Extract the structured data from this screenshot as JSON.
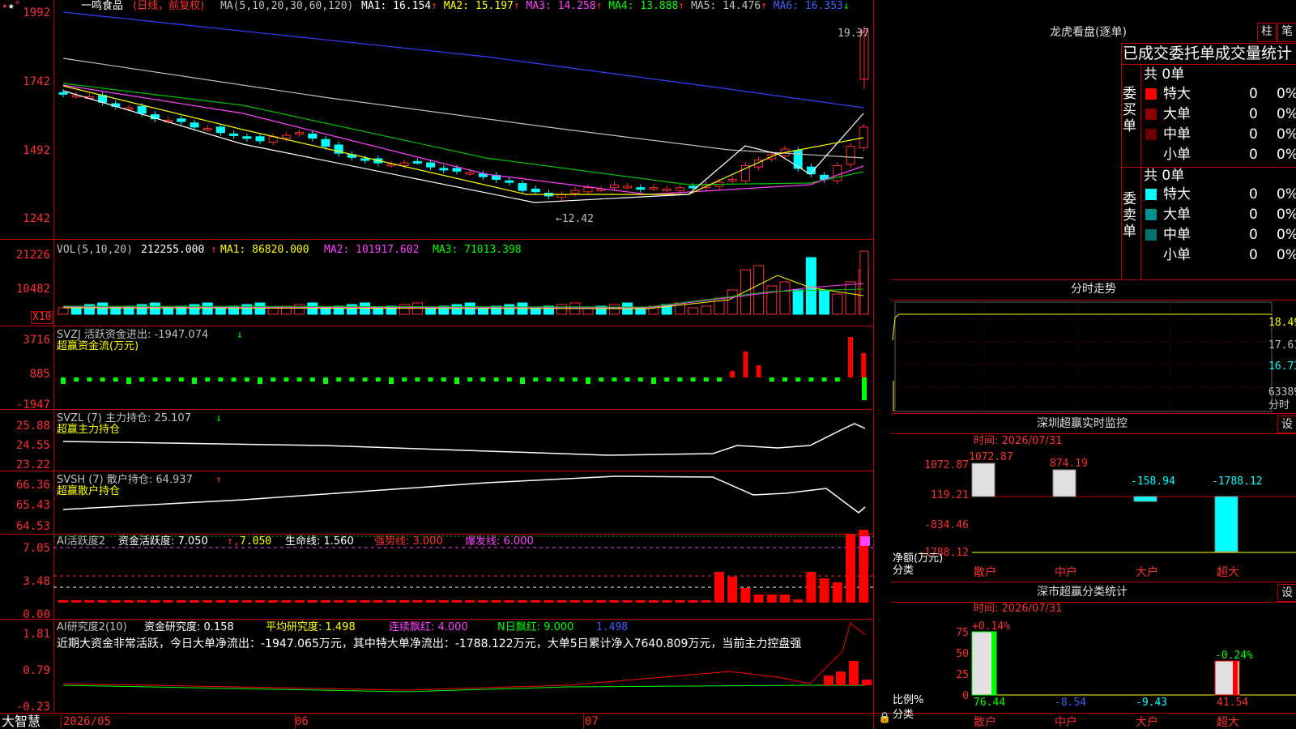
{
  "stock": {
    "name": "一鸣食品",
    "period": "(日线，前复权)"
  },
  "ma": {
    "label": "MA(5,10,20,30,60,120)",
    "items": [
      {
        "name": "MA1:",
        "value": "16.154",
        "arrow": "↑",
        "color": "#ffffff"
      },
      {
        "name": "MA2:",
        "value": "15.197",
        "arrow": "↑",
        "color": "#ffff00"
      },
      {
        "name": "MA3:",
        "value": "14.258",
        "arrow": "↑",
        "color": "#ff40ff"
      },
      {
        "name": "MA4:",
        "value": "13.888",
        "arrow": "↑",
        "color": "#00ff00"
      },
      {
        "name": "MA5:",
        "value": "14.476",
        "arrow": "↑",
        "color": "#c0c0c0"
      },
      {
        "name": "MA6:",
        "value": "16.353",
        "arrow": "↓",
        "color": "#4060ff"
      }
    ]
  },
  "price_axis": [
    "1992",
    "1742",
    "1492",
    "1242"
  ],
  "price_labels": {
    "high": "19.37",
    "low": "←12.42"
  },
  "vol": {
    "label": "VOL(5,10,20)",
    "value": "212255.000",
    "ma1": "MA1: 86820.000",
    "ma2": "MA2: 101917.602",
    "ma3": "MA3: 71013.398",
    "axis": [
      "21226",
      "10482"
    ],
    "unit": "X10"
  },
  "svzj": {
    "label": "SVZJ  活跃资金进出: -1947.074",
    "arrow": "↓",
    "sub": "超赢资金流(万元)",
    "axis": [
      "3716",
      "885",
      "-1947"
    ]
  },
  "svzl": {
    "label": "SVZL (7) 主力持仓: 25.107",
    "arrow": "↓",
    "sub": "超赢主力持仓",
    "axis": [
      "25.88",
      "24.55",
      "23.22"
    ]
  },
  "svsh": {
    "label": "SVSH (7) 散户持仓: 64.937",
    "arrow": "↑",
    "sub": "超赢散户持仓",
    "axis": [
      "66.36",
      "65.43",
      "64.53"
    ]
  },
  "ai1": {
    "label": "AI活跃度2",
    "a": "资金活跃度: 7.050",
    "b": "7.050",
    "c": "生命线: 1.560",
    "d": "强势线: 3.000",
    "e": "爆发线: 6.000",
    "axis": [
      "7.05",
      "3.48",
      "0.00"
    ]
  },
  "ai2": {
    "label": "AI研究度2(10)",
    "a": "资金研究度: 0.158",
    "b": "平均研究度: 1.498",
    "c": "连续飘红: 4.000",
    "d": "N日飘红: 9.000",
    "e": "1.498",
    "summary": "近期大资金非常活跃，今日大单净流出：-1947.065万元，其中特大单净流出：-1788.122万元，大单5日累计净入7640.809万元，当前主力控盘强",
    "axis": [
      "1.81",
      "0.79",
      "-0.23"
    ]
  },
  "date_axis": [
    "2026/05",
    "06",
    "07"
  ],
  "brand": "大智慧",
  "right": {
    "lhb_title": "龙虎看盘(逐单)",
    "btn_zhu": "柱",
    "btn_bi": "笔",
    "stat_title": "已成交委托单成交量统计",
    "buy_label": "委买单",
    "sell_label": "委卖单",
    "buy_total": "共 0单",
    "sell_total": "共 0单",
    "buy_rows": [
      {
        "name": "特大",
        "count": "0",
        "pct": "0%",
        "color": "#ff0000"
      },
      {
        "name": "大单",
        "count": "0",
        "pct": "0%",
        "color": "#8b0000"
      },
      {
        "name": "中单",
        "count": "0",
        "pct": "0%",
        "color": "#6b0000"
      },
      {
        "name": "小单",
        "count": "0",
        "pct": "0%",
        "color": ""
      }
    ],
    "sell_rows": [
      {
        "name": "特大",
        "count": "0",
        "pct": "0%",
        "color": "#00ffff"
      },
      {
        "name": "大单",
        "count": "0",
        "pct": "0%",
        "color": "#009090"
      },
      {
        "name": "中单",
        "count": "0",
        "pct": "0%",
        "color": "#007070"
      },
      {
        "name": "小单",
        "count": "0",
        "pct": "0%",
        "color": ""
      }
    ],
    "fenshi_title": "分时走势",
    "fenshi_axis": [
      "18.49",
      "17.61",
      "16.73",
      "63389"
    ],
    "fenshi_label": "分时",
    "sz_title": "深圳超赢实时监控",
    "sz_btn": "设",
    "sz_time": "时间: 2026/07/31",
    "sz_axis": [
      "1072.87",
      "119.21",
      "-834.46",
      "-1788.12"
    ],
    "sz_net_label": "净额(万元)",
    "sz_cat_label": "分类",
    "sz_cats": [
      "散户",
      "中户",
      "大户",
      "超大"
    ],
    "sz_values": [
      "1072.87",
      "874.19",
      "-158.94",
      "-1788.12"
    ],
    "sc_title": "深市超赢分类统计",
    "sc_btn": "设",
    "sc_time": "时间: 2026/07/31",
    "sc_axis": [
      "75",
      "50",
      "25",
      "0"
    ],
    "sc_ratio_label": "比例%",
    "sc_cat_label": "分类",
    "sc_top": [
      "+0.14%",
      "-0.24%"
    ],
    "sc_values": [
      "76.44",
      "-8.54",
      "-9.43",
      "41.54"
    ],
    "sc_cats": [
      "散户",
      "中户",
      "大户",
      "超大"
    ]
  }
}
